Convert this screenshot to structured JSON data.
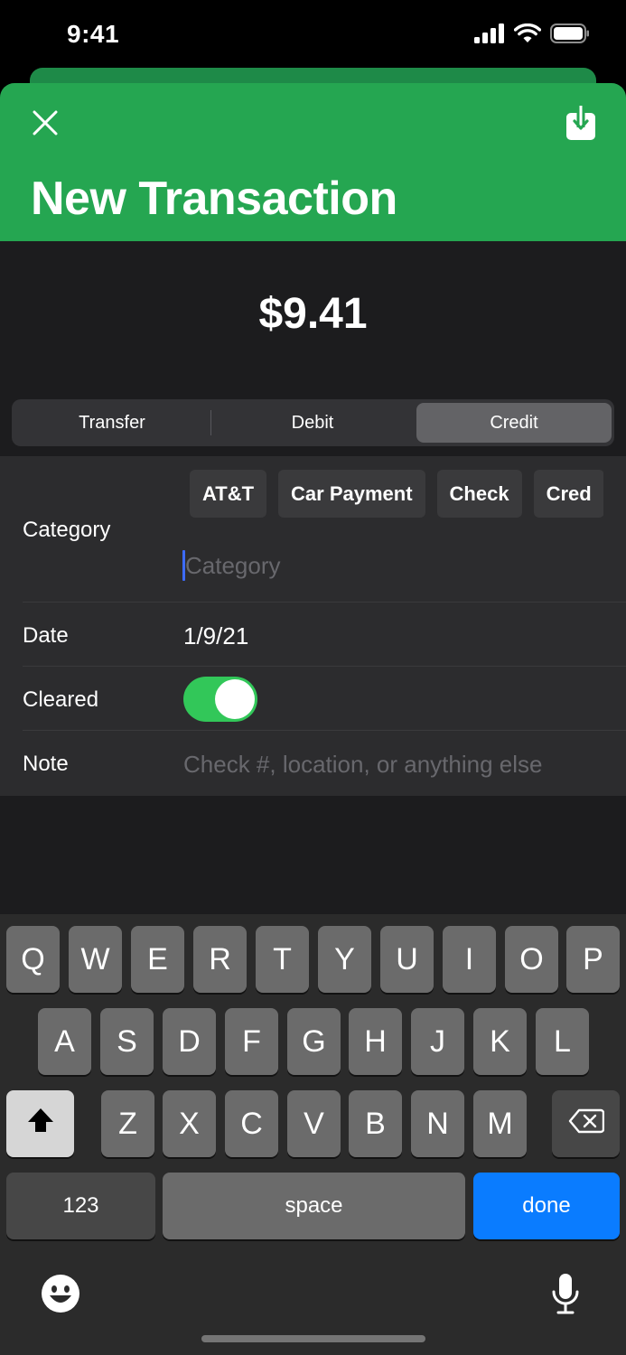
{
  "status_bar": {
    "time": "9:41"
  },
  "header": {
    "title": "New Transaction"
  },
  "amount": "$9.41",
  "segmented": {
    "options": [
      "Transfer",
      "Debit",
      "Credit"
    ],
    "selected": "Credit"
  },
  "form": {
    "category": {
      "label": "Category",
      "suggestions": [
        "AT&T",
        "Car Payment",
        "Check",
        "Cred"
      ],
      "placeholder": "Category",
      "value": ""
    },
    "date": {
      "label": "Date",
      "value": "1/9/21"
    },
    "cleared": {
      "label": "Cleared",
      "on": true
    },
    "note": {
      "label": "Note",
      "placeholder": "Check #, location, or anything else",
      "value": ""
    }
  },
  "keyboard": {
    "row1": [
      "Q",
      "W",
      "E",
      "R",
      "T",
      "Y",
      "U",
      "I",
      "O",
      "P"
    ],
    "row2": [
      "A",
      "S",
      "D",
      "F",
      "G",
      "H",
      "J",
      "K",
      "L"
    ],
    "row3": [
      "Z",
      "X",
      "C",
      "V",
      "B",
      "N",
      "M"
    ],
    "numbers_label": "123",
    "space_label": "space",
    "done_label": "done"
  },
  "colors": {
    "header_green": "#25a651",
    "toggle_on": "#32c759",
    "done_blue": "#0a7cff",
    "caret_blue": "#3d6bff"
  }
}
